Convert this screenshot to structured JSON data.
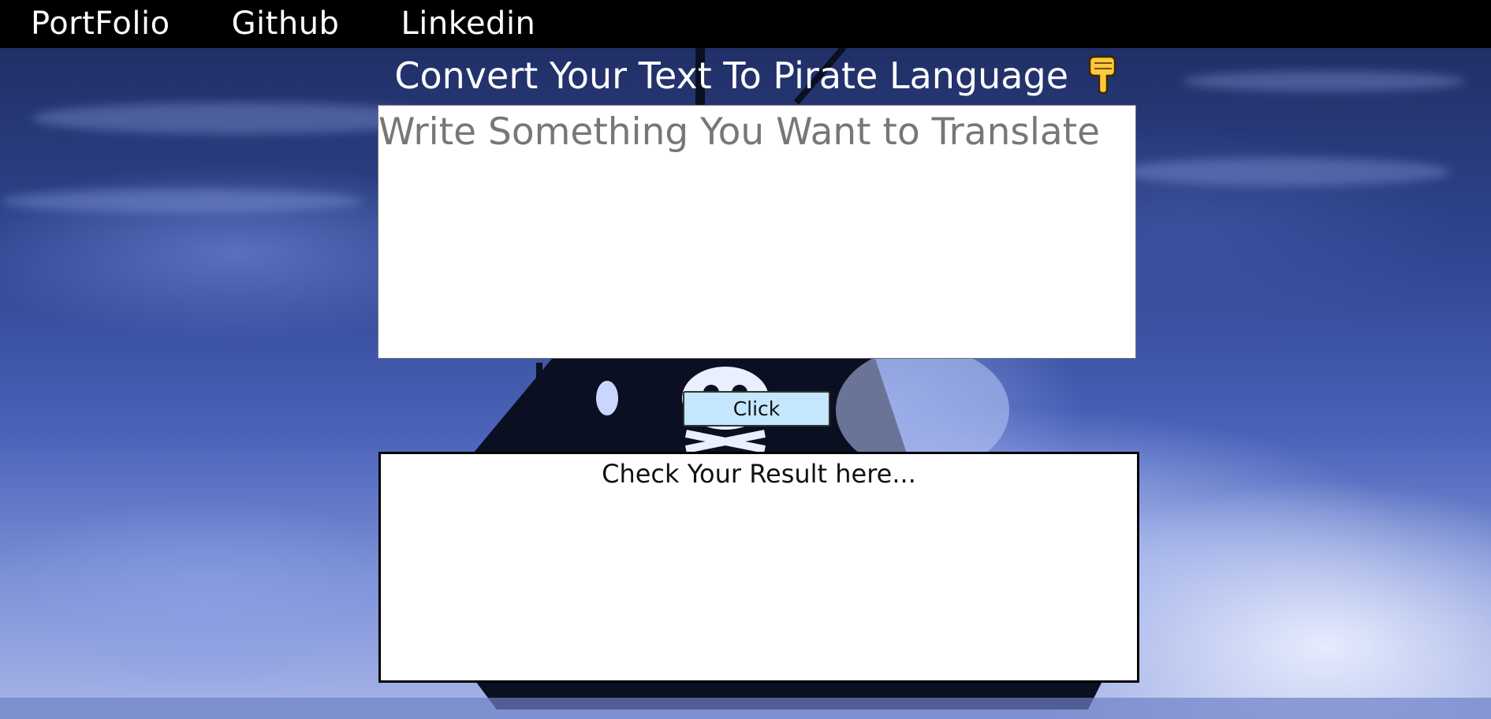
{
  "nav": {
    "links": [
      {
        "label": "PortFolio"
      },
      {
        "label": "Github"
      },
      {
        "label": "Linkedin"
      }
    ]
  },
  "header": {
    "title": "Convert Your Text To Pirate Language",
    "title_icon": "pointing-down-hand-icon"
  },
  "translator": {
    "input_placeholder": "Write Something You Want to Translate",
    "input_value": "",
    "button_label": "Click",
    "output_text": "Check Your Result here..."
  },
  "colors": {
    "navbar_bg": "#000000",
    "button_bg": "#c5e7fd",
    "background": "#2f4590"
  }
}
